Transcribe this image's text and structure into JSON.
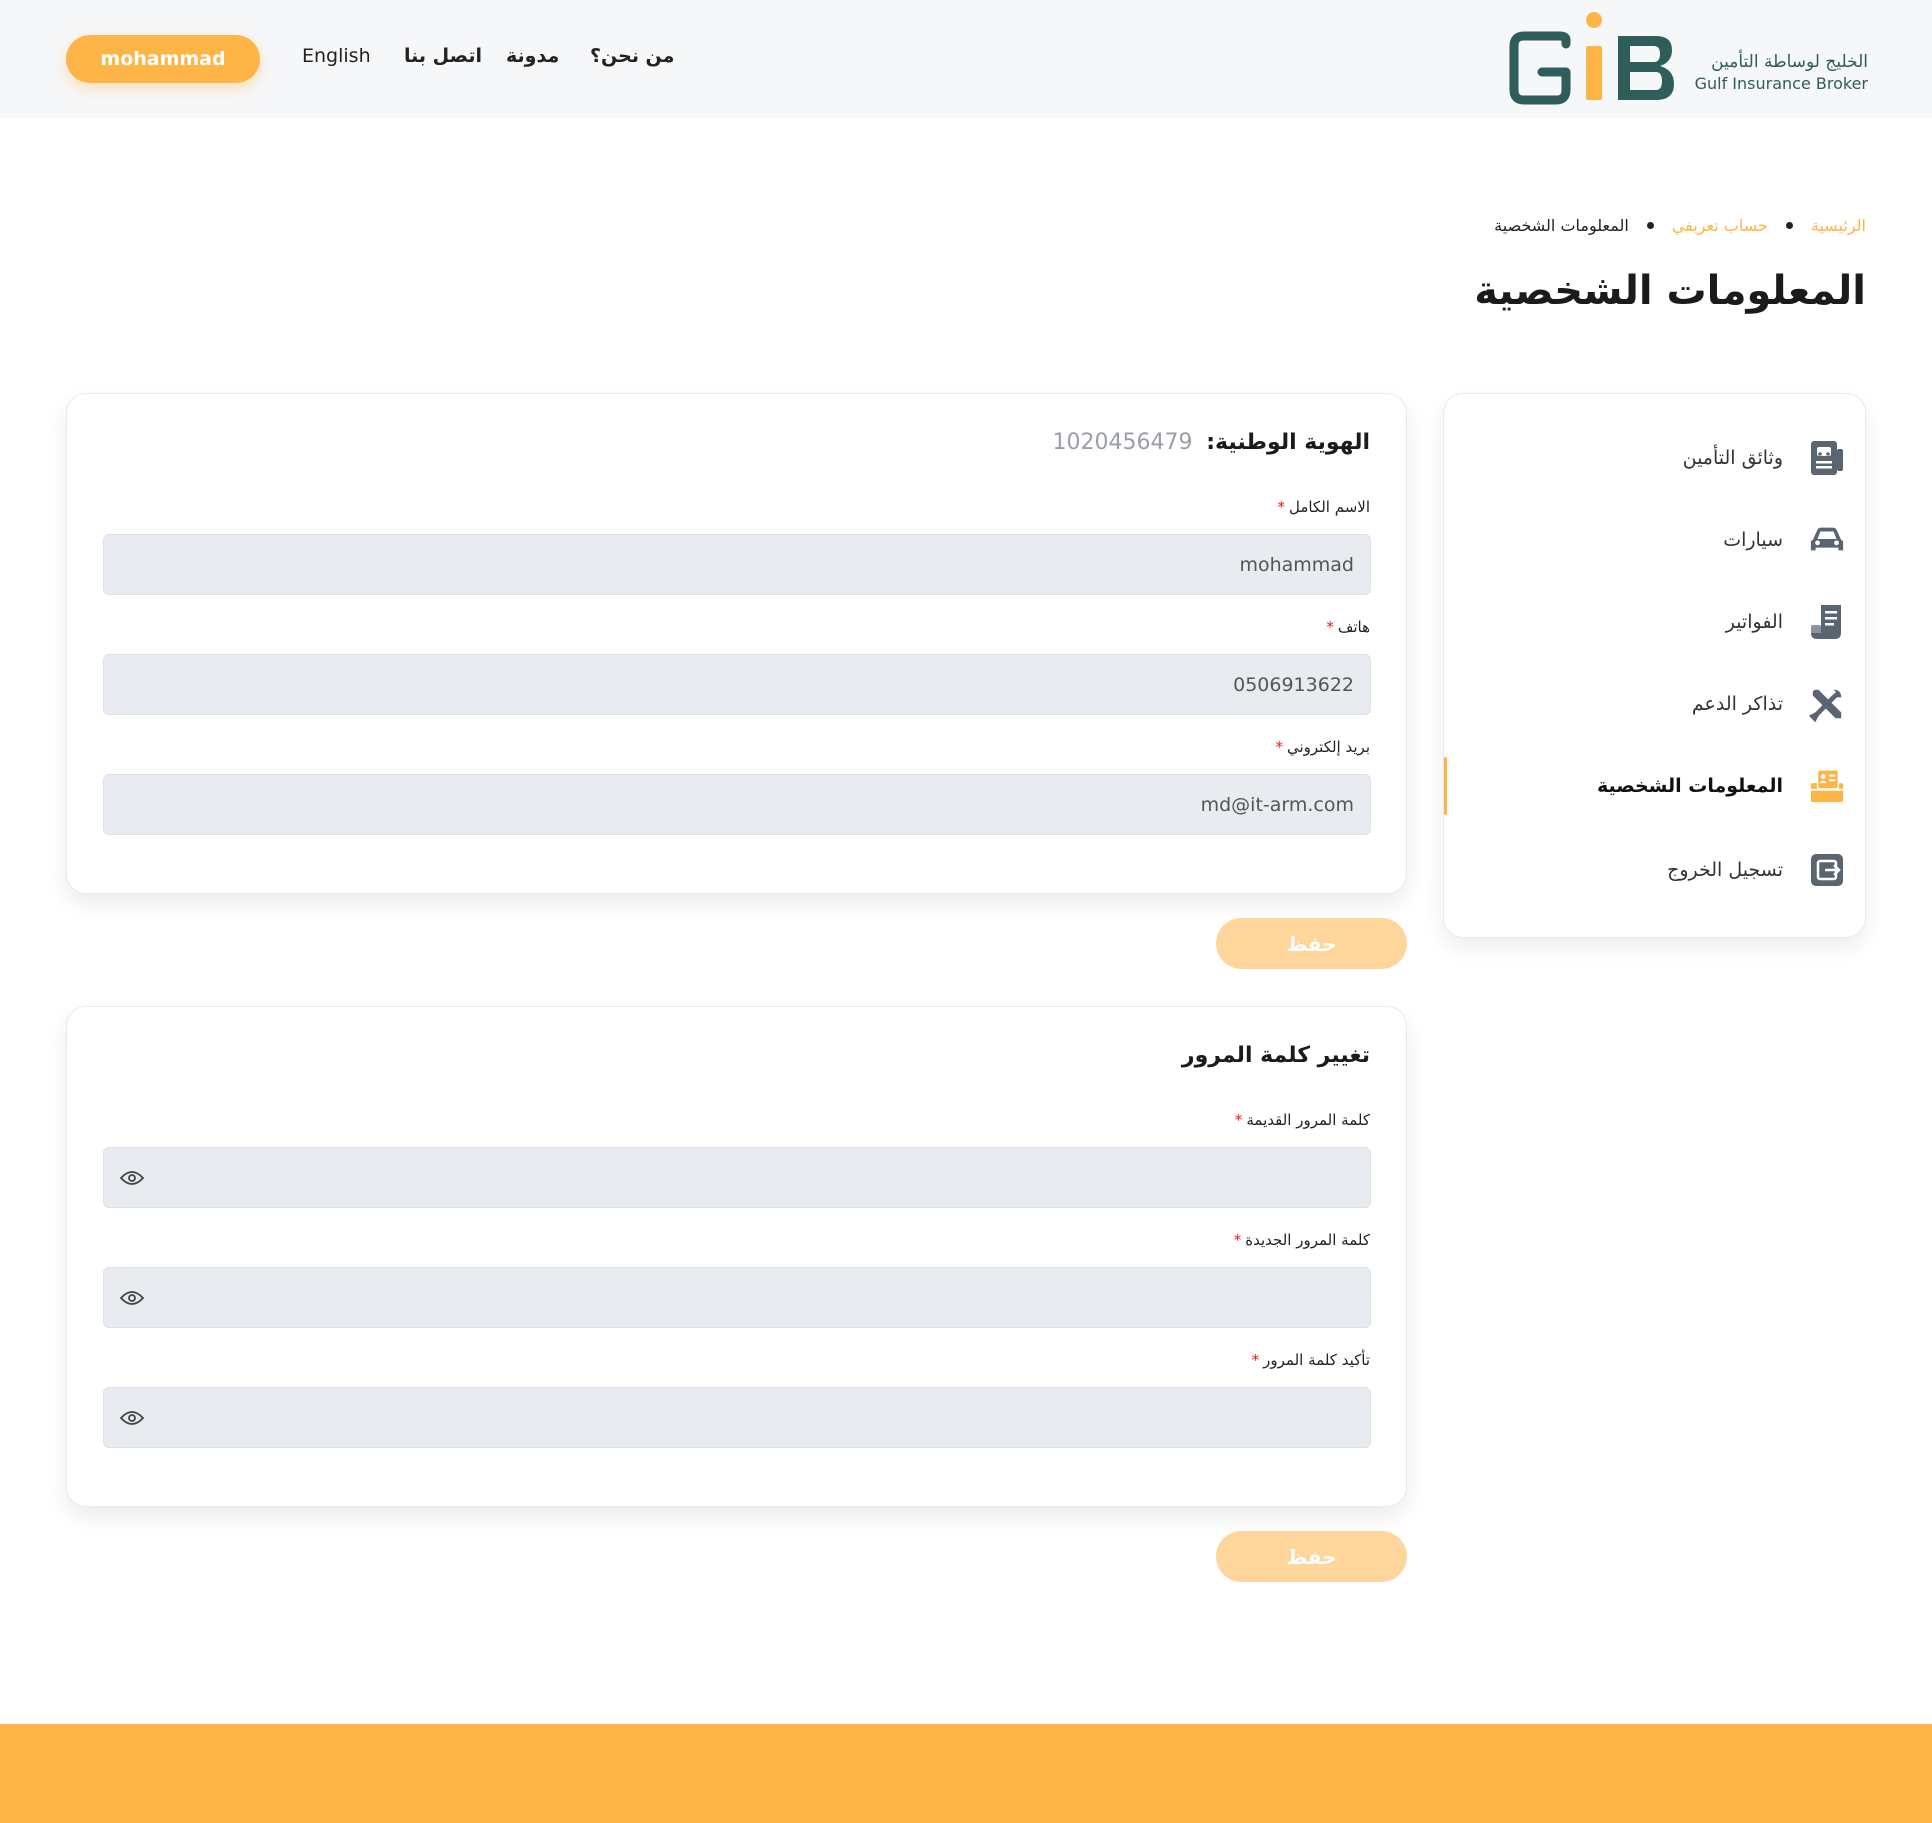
{
  "header": {
    "user_button": "mohammad",
    "nav": {
      "english": "English",
      "contact": "اتصل بنا",
      "blog": "مدونة",
      "about": "من نحن؟"
    },
    "logo": {
      "text_ar": "الخليج لوساطة التأمين",
      "text_en": "Gulf Insurance Broker",
      "mark": "GIB"
    }
  },
  "breadcrumb": {
    "home": "الرئيسية",
    "profile": "حساب تعريفي",
    "current": "المعلومات الشخصية"
  },
  "page_title": "المعلومات الشخصية",
  "sidebar": {
    "items": [
      {
        "label": "وثائق التأمين",
        "icon": "insurance-documents-icon"
      },
      {
        "label": "سيارات",
        "icon": "car-icon"
      },
      {
        "label": "الفواتير",
        "icon": "invoice-icon"
      },
      {
        "label": "تذاكر الدعم",
        "icon": "tools-icon"
      },
      {
        "label": "المعلومات الشخصية",
        "icon": "id-card-icon",
        "active": true
      },
      {
        "label": "تسجيل الخروج",
        "icon": "logout-icon"
      }
    ]
  },
  "personal_info": {
    "id_label": "الهوية الوطنية:",
    "id_value": "1020456479",
    "full_name_label": "الاسم الكامل",
    "full_name_value": "mohammad",
    "phone_label": "هاتف",
    "phone_value": "0506913622",
    "email_label": "بريد إلكتروني",
    "email_value": "md@it-arm.com",
    "required_mark": "*",
    "save_label": "حفظ"
  },
  "change_password": {
    "title": "تغيير كلمة المرور",
    "old_label": "كلمة المرور القديمة",
    "new_label": "كلمة المرور الجديدة",
    "confirm_label": "تأكيد كلمة المرور",
    "required_mark": "*",
    "save_label": "حفظ"
  },
  "colors": {
    "accent": "#feb548",
    "accent_disabled": "#fed69c",
    "brand_teal": "#2f5d5a",
    "required": "#e21b1b",
    "field_bg": "#e8ebef"
  }
}
